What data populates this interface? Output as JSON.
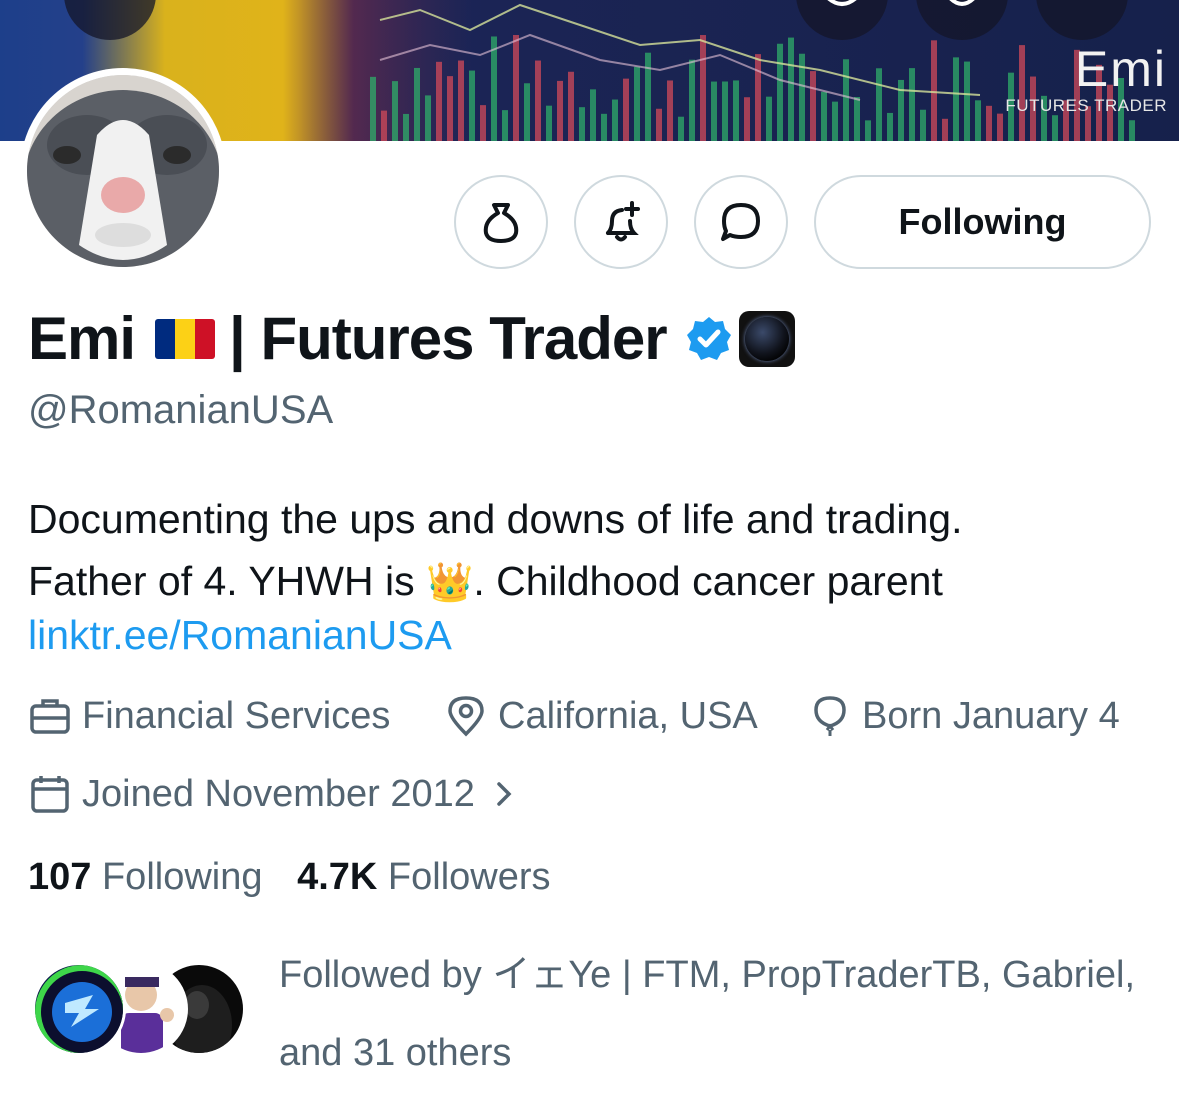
{
  "banner": {
    "logo_name": "Emi",
    "logo_subtitle": "FUTURES TRADER"
  },
  "profile": {
    "display_name": "Emi",
    "display_name_suffix": "| Futures Trader",
    "handle": "@RomanianUSA",
    "bio_line1": "Documenting the ups and downs of life and trading.",
    "bio_line2_prefix": "Father of 4. YHWH is",
    "bio_line2_emoji": "👑",
    "bio_line2_suffix": ". Childhood cancer parent",
    "link": "linktr.ee/RomanianUSA",
    "category": "Financial Services",
    "location": "California, USA",
    "birthday": "Born January 4",
    "joined": "Joined November 2012",
    "following_count": "107",
    "following_label": "Following",
    "followers_count": "4.7K",
    "followers_label": "Followers",
    "followed_by_line1": "Followed by イェYe | FTM, PropTraderTB, Gabriel,",
    "followed_by_line2": "and 31 others"
  },
  "actions": {
    "follow_state_label": "Following"
  },
  "colors": {
    "accent": "#1d9bf0",
    "muted_text": "#536471",
    "border": "#cfd9de",
    "verified": "#1d9bf0"
  },
  "icons": {
    "tip": "money-bag-icon",
    "notify": "bell-plus-icon",
    "message": "message-bubble-icon",
    "category": "briefcase-icon",
    "location": "location-pin-icon",
    "birthday": "balloon-icon",
    "joined": "calendar-icon",
    "chevron": "chevron-right-icon"
  }
}
